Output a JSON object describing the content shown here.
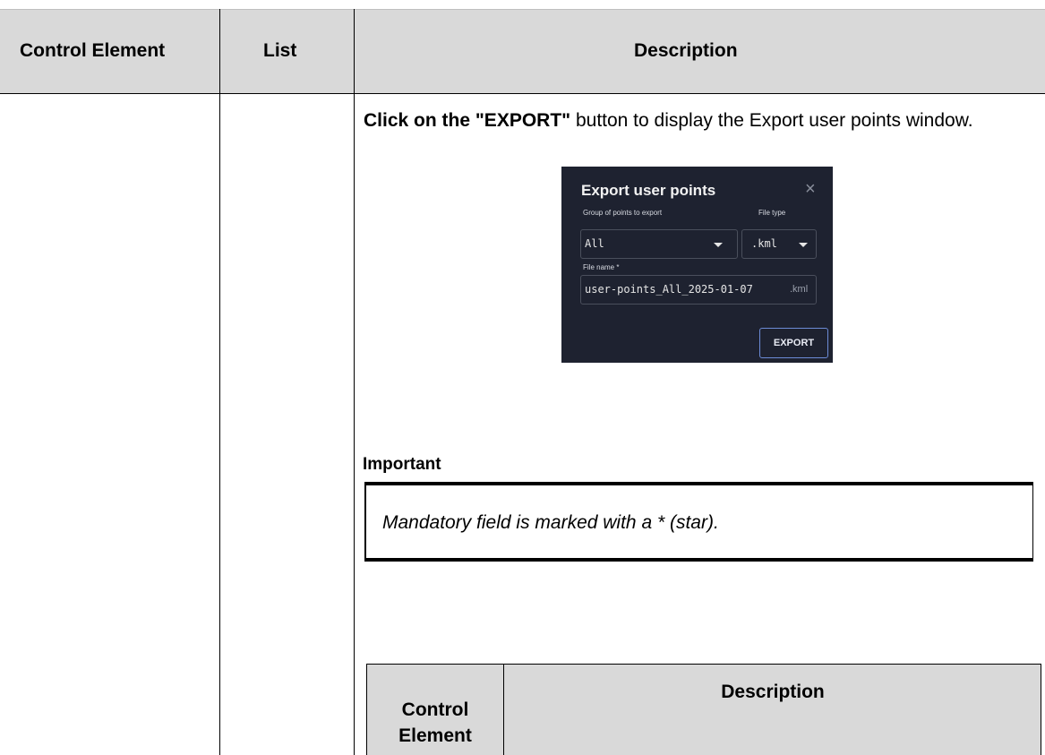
{
  "table": {
    "headers": [
      "Control Element",
      "List",
      "Description"
    ]
  },
  "intro": {
    "bold_text": "Click on the \"EXPORT\"",
    "rest_text": " button to display the Export user points window."
  },
  "dialog": {
    "title": "Export user points",
    "close_glyph": "×",
    "group_label": "Group of points to export",
    "group_value": "All",
    "filetype_label": "File type",
    "filetype_value": ".kml",
    "filename_label": "File name *",
    "filename_value": "user-points_All_2025-01-07",
    "filename_suffix": ".kml",
    "export_button": "EXPORT",
    "colors": {
      "background": "#1e2230",
      "button_border": "#6c8bd6"
    }
  },
  "important": {
    "title": "Important",
    "text": "Mandatory field is marked with a * (star)."
  },
  "sub_table": {
    "headers": [
      "Control Element",
      "Description"
    ]
  }
}
